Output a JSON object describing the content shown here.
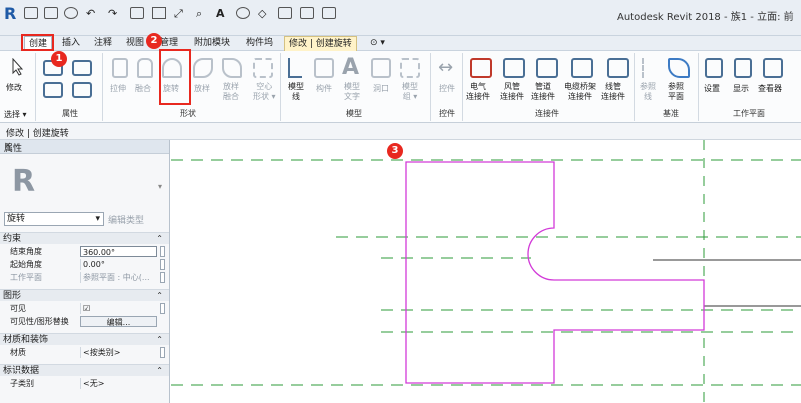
{
  "window": {
    "title": "Autodesk Revit 2018 -   族1 - 立面: 前",
    "logo": "R"
  },
  "tabs": [
    {
      "label": "创建"
    },
    {
      "label": "插入"
    },
    {
      "label": "注释"
    },
    {
      "label": "视图"
    },
    {
      "label": "管理"
    },
    {
      "label": "附加模块"
    },
    {
      "label": "构件坞"
    },
    {
      "label": "修改 | 创建旋转"
    },
    {
      "label": "⊙ ▾"
    }
  ],
  "ribbon": {
    "select": {
      "modify": "修改",
      "select": "选择 ▾"
    },
    "properties_panel_label": "属性",
    "shape_tools": [
      {
        "label": "拉伸"
      },
      {
        "label": "融合"
      },
      {
        "label": "旋转"
      },
      {
        "label": "放样"
      },
      {
        "label": "放样\n融合"
      },
      {
        "label": "空心\n形状 ▾"
      }
    ],
    "shape_panel_label": "形状",
    "model_tools": [
      {
        "label": "模型\n线"
      },
      {
        "label": "构件"
      },
      {
        "label": "模型\n文字"
      },
      {
        "label": "洞口"
      },
      {
        "label": "模型\n组 ▾"
      }
    ],
    "model_panel_label": "模型",
    "control_tool": {
      "label": "控件"
    },
    "control_panel_label": "控件",
    "connector_tools": [
      {
        "label": "电气\n连接件"
      },
      {
        "label": "风管\n连接件"
      },
      {
        "label": "管道\n连接件"
      },
      {
        "label": "电缆桥架\n连接件"
      },
      {
        "label": "线管\n连接件"
      }
    ],
    "connector_panel_label": "连接件",
    "datum_tools": [
      {
        "label": "参照\n线"
      },
      {
        "label": "参照\n平面"
      }
    ],
    "datum_panel_label": "基准",
    "workplane_tools": [
      {
        "label": "设置"
      },
      {
        "label": "显示"
      },
      {
        "label": "查看器"
      }
    ],
    "workplane_panel_label": "工作平面"
  },
  "context_bar": {
    "text": "修改 | 创建旋转"
  },
  "properties": {
    "title": "属性",
    "close": "×",
    "type_selector": "旋转",
    "edit_type": "编辑类型",
    "sections": [
      {
        "name": "约束",
        "rows": [
          {
            "key": "结束角度",
            "value": "360.00°"
          },
          {
            "key": "起始角度",
            "value": "0.00°"
          },
          {
            "key": "工作平面",
            "value": "参照平面 : 中心(..."
          }
        ]
      },
      {
        "name": "图形",
        "rows": [
          {
            "key": "可见",
            "value": "☑"
          },
          {
            "key": "可见性/图形替换",
            "value": "编辑..."
          }
        ]
      },
      {
        "name": "材质和装饰",
        "rows": [
          {
            "key": "材质",
            "value": "<按类别>"
          }
        ]
      },
      {
        "name": "标识数据",
        "rows": [
          {
            "key": "子类别",
            "value": "<无>"
          }
        ]
      }
    ]
  },
  "callouts": {
    "c1": "1",
    "c2": "2",
    "c3": "3"
  },
  "colors": {
    "sketch_line": "#d23ad8",
    "ref_plane": "#2e9b3a",
    "callout": "#e8281f"
  }
}
